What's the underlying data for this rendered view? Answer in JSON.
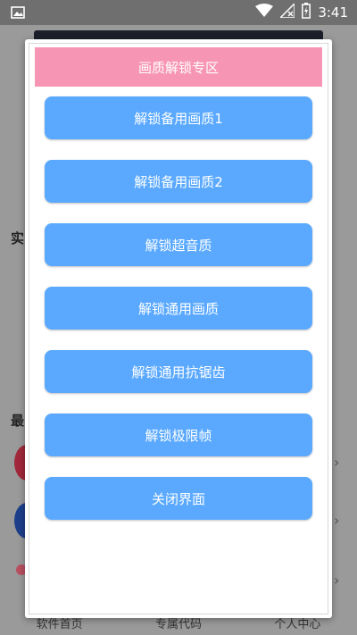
{
  "status_bar": {
    "time": "3:41",
    "icons": [
      "image-icon",
      "wifi-icon",
      "signal-off-icon",
      "battery-charging-icon"
    ]
  },
  "background_app": {
    "section_label_1": "实",
    "section_label_2": "最",
    "nav": {
      "home": "软件首页",
      "code": "专属代码",
      "profile": "个人中心"
    }
  },
  "dialog": {
    "title": "画质解锁专区",
    "options": [
      {
        "label": "解锁备用画质1"
      },
      {
        "label": "解锁备用画质2"
      },
      {
        "label": "解锁超音质"
      },
      {
        "label": "解锁通用画质"
      },
      {
        "label": "解锁通用抗锯齿"
      },
      {
        "label": "解锁极限帧"
      },
      {
        "label": "关闭界面"
      }
    ]
  },
  "colors": {
    "title_bg": "#f796b4",
    "button_bg": "#5aa9ff",
    "button_text": "#ffffff"
  }
}
